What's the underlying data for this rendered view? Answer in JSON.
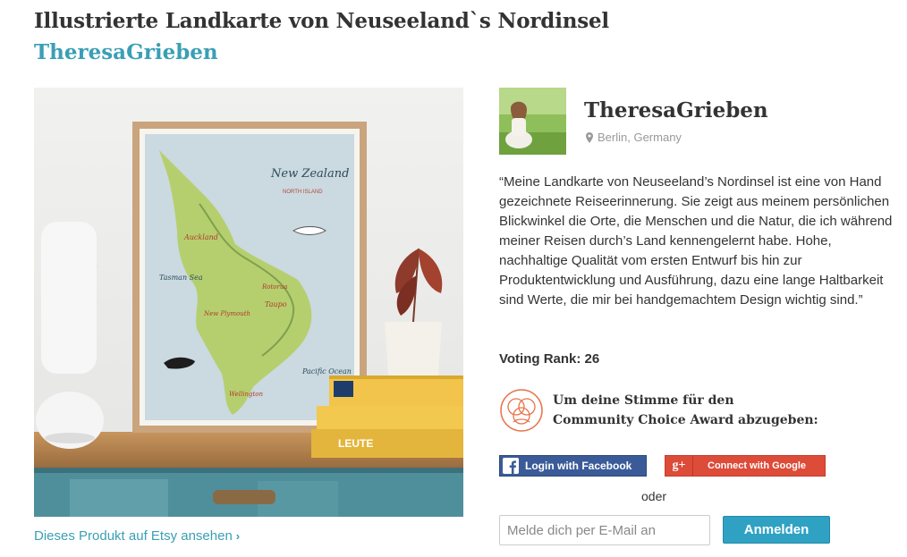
{
  "page": {
    "title": "Illustrierte Landkarte von Neuseeland`s Nordinsel",
    "artist_link": "TheresaGrieben"
  },
  "product": {
    "etsy_link": "Dieses Produkt auf Etsy ansehen",
    "image_map_texts": {
      "heading": "New Zealand",
      "subheading": "NORTH ISLAND",
      "auckland": "Auckland",
      "wellington": "Wellington",
      "tasman": "Tasman Sea",
      "new_plymouth": "New Plymouth",
      "pacific": "Pacific Ocean",
      "taupo": "Taupo",
      "rotorua": "Rotorua",
      "book_label": "LEUTE"
    }
  },
  "artist": {
    "name": "TheresaGrieben",
    "location": "Berlin, Germany",
    "quote": "“Meine Landkarte von Neuseeland’s Nordinsel ist eine von Hand gezeichnete Reiseerinnerung. Sie zeigt aus meinem persönlichen Blickwinkel die Orte, die Menschen und die Natur, die ich während meiner Reisen durch’s Land kennengelernt habe. Hohe, nachhaltige Qualität vom ersten Entwurf bis hin zur Produktentwicklung und Ausführung, dazu eine lange Haltbarkeit sind Werte, die mir bei handgemachtem Design wichtig sind.”"
  },
  "voting": {
    "rank_label": "Voting Rank: 26",
    "award_line1": "Um deine Stimme für den",
    "award_line2": "Community Choice Award abzugeben:",
    "facebook_button": "Login with Facebook",
    "google_icon": "g+",
    "google_button": "Connect with Google",
    "or_text": "oder",
    "email_placeholder": "Melde dich per E-Mail an",
    "submit_button": "Anmelden"
  },
  "icons": {
    "location": "location-pin-icon",
    "award": "community-award-icon",
    "facebook": "facebook-icon",
    "google": "google-plus-icon",
    "chevron": "chevron-right-icon"
  },
  "colors": {
    "accent": "#3a9fb5",
    "facebook": "#3b5b98",
    "google": "#dd4b39",
    "submit": "#2fa2c3",
    "award_icon": "#e8734a"
  }
}
